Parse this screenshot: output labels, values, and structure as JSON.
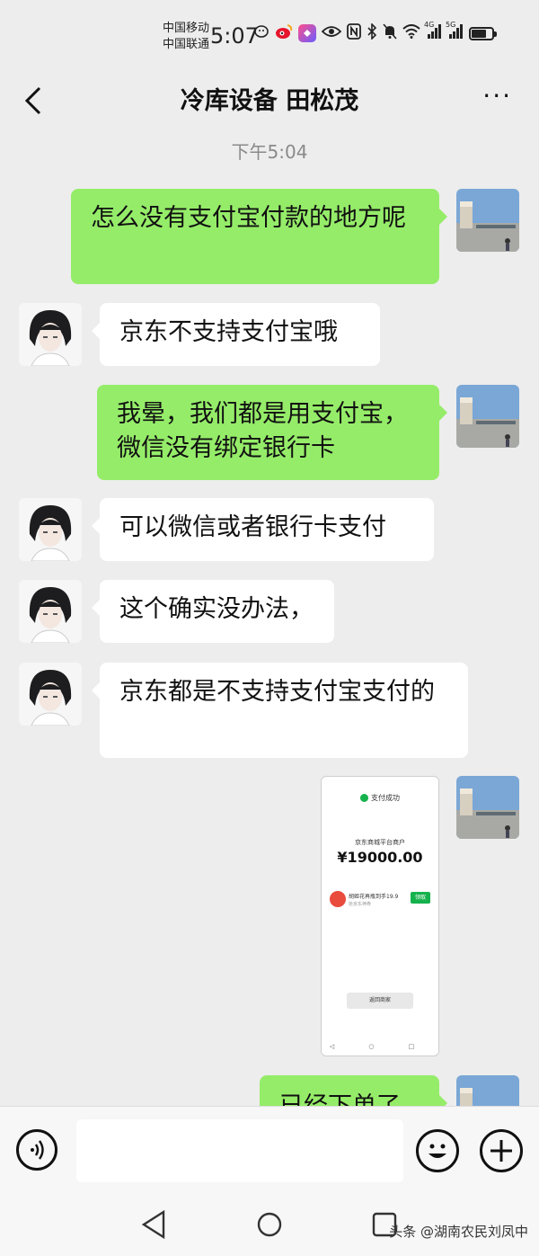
{
  "status_bar": {
    "carrier_1": "中国移动",
    "carrier_2": "中国联通",
    "time": "5:07",
    "icons": [
      "qq-icon",
      "weibo-icon",
      "app-icon",
      "eye-icon",
      "nfc-icon",
      "bluetooth-icon",
      "mute-icon",
      "wifi-icon",
      "signal-4g-icon",
      "signal-5g-icon",
      "battery-icon"
    ],
    "signal_labels": [
      "4G",
      "5G"
    ],
    "battery_level": 0.75
  },
  "header": {
    "title": "冷库设备 田松茂",
    "more_label": "···"
  },
  "chat": {
    "timestamp": "下午5:04",
    "messages": [
      {
        "side": "out",
        "text": "怎么没有支付宝付款的地方呢"
      },
      {
        "side": "in",
        "text": "京东不支持支付宝哦"
      },
      {
        "side": "out",
        "text": "我晕，我们都是用支付宝，微信没有绑定银行卡"
      },
      {
        "side": "in",
        "text": "可以微信或者银行卡支付"
      },
      {
        "side": "in",
        "text": "这个确实没办法，"
      },
      {
        "side": "in",
        "text": "京东都是不支持支付宝支付的"
      },
      {
        "side": "out",
        "type": "image",
        "screenshot": {
          "status": "支付成功",
          "merchant": "京东商城平台商户",
          "amount": "¥19000.00",
          "promo_text": "胡姬花再瓶到手19.9",
          "promo_sub": "抢京东神券",
          "promo_button": "领取",
          "return_button": "返回商家"
        }
      },
      {
        "side": "out",
        "text": "已经下单了"
      }
    ]
  },
  "input_bar": {
    "placeholder": ""
  },
  "watermark": "头条 @湖南农民刘凤中",
  "colors": {
    "outgoing_bubble": "#95ec69",
    "incoming_bubble": "#ffffff",
    "background": "#ededed",
    "success_green": "#16b24d"
  }
}
